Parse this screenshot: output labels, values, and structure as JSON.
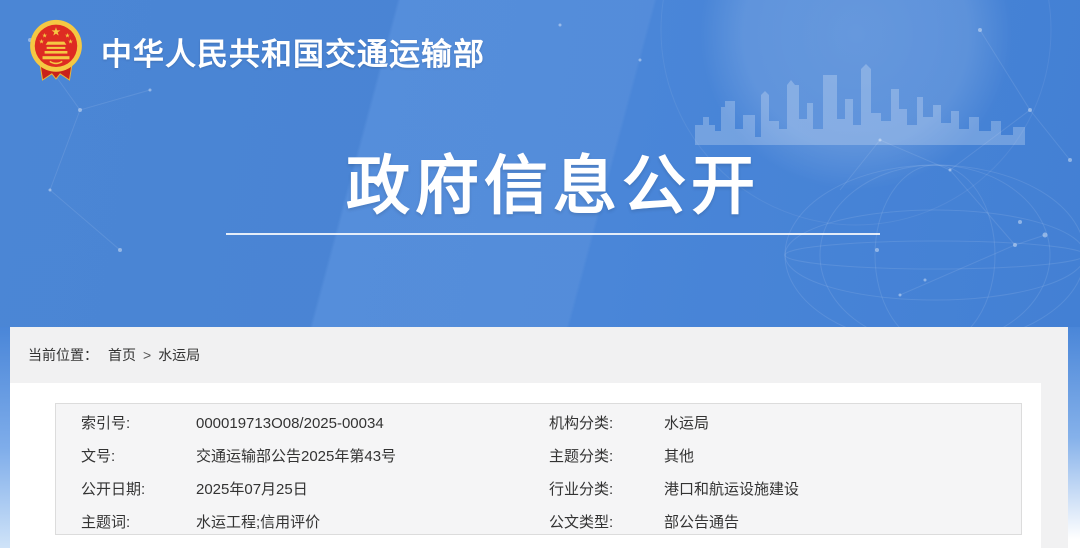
{
  "colors": {
    "banner_blue": "#4a86d8",
    "banner_blue_dark": "#4380d4",
    "page_gray": "#f1f1f2",
    "card_white": "#ffffff",
    "infobox_gray": "#f5f5f6",
    "infobox_border": "#dcdcdc",
    "text_dark": "#333333",
    "title_white": "#ffffff",
    "emblem_gold": "#f5c843",
    "emblem_red": "#de2b22"
  },
  "header": {
    "site_title": "中华人民共和国交通运输部",
    "page_title": "政府信息公开",
    "emblem_icon": "china-national-emblem"
  },
  "breadcrumb": {
    "label": "当前位置：",
    "items": [
      "首页",
      "水运局"
    ],
    "separator": ">"
  },
  "infobox": {
    "rows": [
      {
        "label": "索引号:",
        "value": "000019713O08/2025-00034"
      },
      {
        "label": "机构分类:",
        "value": "水运局"
      },
      {
        "label": "文号:",
        "value": "交通运输部公告2025年第43号"
      },
      {
        "label": "主题分类:",
        "value": "其他"
      },
      {
        "label": "公开日期:",
        "value": "2025年07月25日"
      },
      {
        "label": "行业分类:",
        "value": "港口和航运设施建设"
      },
      {
        "label": "主题词:",
        "value": "水运工程;信用评价"
      },
      {
        "label": "公文类型:",
        "value": "部公告通告"
      }
    ]
  }
}
